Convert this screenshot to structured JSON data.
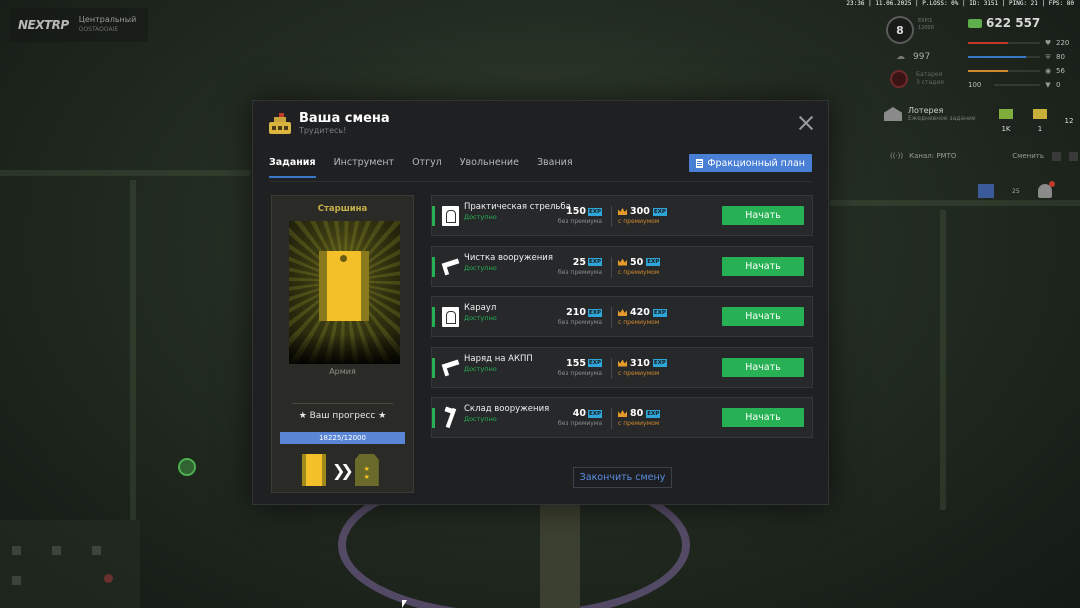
{
  "hud": {
    "logo": "NEXTRP",
    "server_line1": "Центральный",
    "server_line2": "OOSTAOOAIE",
    "status_line": "23:36 | 11.06.2025 | P.LOSS: 0% | ID: 3151 | PING: 21 | FPS: 80",
    "level": "8",
    "level_sub1": "EXP/1",
    "level_sub2": "12000",
    "money": "622 557",
    "bars": [
      {
        "icon": "heart",
        "value": "220",
        "fill": 0.55,
        "color": "#c0392b"
      },
      {
        "icon": "shield",
        "value": "80",
        "fill": 0.8,
        "color": "#3a78c7"
      },
      {
        "icon": "food",
        "value": "56",
        "fill": 0.56,
        "color": "#d08a2e"
      },
      {
        "icon": "water",
        "value": "0",
        "fill": 0.0,
        "color": "#3a78c7"
      }
    ],
    "bar_100": "100",
    "stat_997": "997",
    "battery_line1": "Батарея",
    "battery_line2": "3 стадия",
    "lottery_title": "Лотерея",
    "lottery_sub": "Ежедневное задание",
    "ticket_1": "1K",
    "ticket_2": "1",
    "ticket_3": "12",
    "channel": "Канал: РМТО",
    "channel_switch": "Сменить",
    "icon_badge": "25"
  },
  "modal": {
    "title": "Ваша смена",
    "subtitle": "Трудитесь!",
    "tabs": [
      "Задания",
      "Инструмент",
      "Отгул",
      "Увольнение",
      "Звания"
    ],
    "active_tab": 0,
    "faction_plan_label": "Фракционный план",
    "rank": {
      "name": "Старшина",
      "faction": "Армия",
      "progress_label": "★ Ваш прогресс ★",
      "progress_text": "18225/12000",
      "progress_fill": 1.0
    },
    "reward_base_label": "без премиума",
    "reward_prem_label": "с премиумом",
    "exp_label": "EXP",
    "start_label": "Начать",
    "tasks": [
      {
        "icon": "target",
        "name": "Практическая стрельба",
        "status": "Доступно",
        "base": "150",
        "prem": "300"
      },
      {
        "icon": "rifle",
        "name": "Чистка вооружения",
        "status": "Доступно",
        "base": "25",
        "prem": "50"
      },
      {
        "icon": "target",
        "name": "Караул",
        "status": "Доступно",
        "base": "210",
        "prem": "420"
      },
      {
        "icon": "rifle",
        "name": "Наряд на АКПП",
        "status": "Доступно",
        "base": "155",
        "prem": "310"
      },
      {
        "icon": "tool",
        "name": "Склад вооружения",
        "status": "Доступно",
        "base": "40",
        "prem": "80"
      }
    ],
    "finish_label": "Закончить смену"
  },
  "colors": {
    "accent_green": "#27b154",
    "accent_blue": "#4a7fd6",
    "rank_gold": "#c6b04a",
    "premium_orange": "#d08a2e",
    "exp_cyan": "#2fa6d9"
  }
}
